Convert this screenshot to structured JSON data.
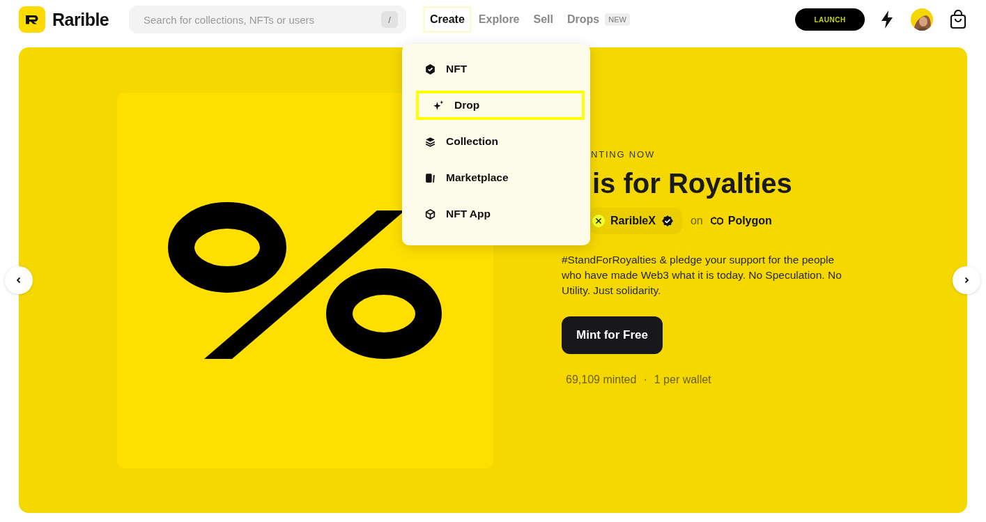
{
  "header": {
    "logo": {
      "text": "Rarible"
    },
    "search": {
      "placeholder": "Search for collections, NFTs or users",
      "shortcut": "/"
    },
    "nav": [
      {
        "label": "Create",
        "selected": true
      },
      {
        "label": "Explore",
        "selected": false
      },
      {
        "label": "Sell",
        "selected": false
      },
      {
        "label": "Drops",
        "selected": false,
        "badge": "NEW"
      }
    ],
    "launch_button": "LAUNCH"
  },
  "create_menu": {
    "items": [
      {
        "label": "NFT",
        "selected": false
      },
      {
        "label": "Drop",
        "selected": true
      },
      {
        "label": "Collection",
        "selected": false
      },
      {
        "label": "Marketplace",
        "selected": false
      },
      {
        "label": "NFT App",
        "selected": false
      }
    ]
  },
  "hero": {
    "eyebrow": "NTING NOW",
    "title": "is for Royalties",
    "creator": "RaribleX",
    "on": "on",
    "chain": "Polygon",
    "description": "#StandForRoyalties & pledge your support for the people who have made Web3 what it is today. No Speculation. No Utility. Just solidarity.",
    "button": "Mint for Free",
    "minted": "69,109 minted",
    "separator": "·",
    "limit": "1 per wallet"
  }
}
